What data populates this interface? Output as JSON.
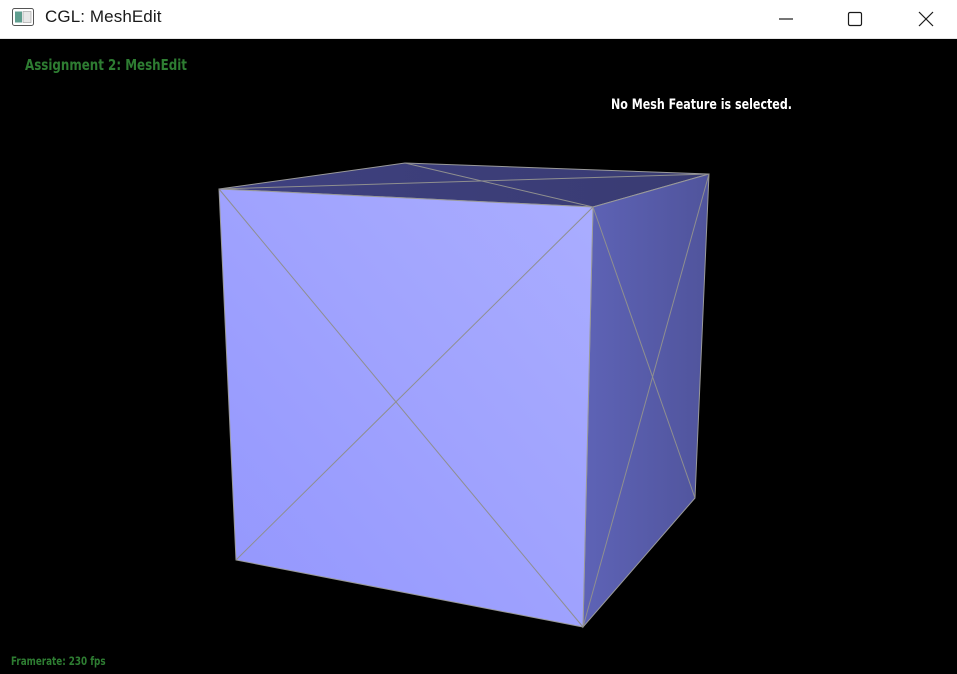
{
  "window": {
    "title": "CGL: MeshEdit",
    "controls": {
      "minimize": "minimize-icon",
      "maximize": "maximize-icon",
      "close": "close-icon"
    }
  },
  "viewport": {
    "background": "#000000",
    "assignment_title": "Assignment 2: MeshEdit",
    "selection_status": "No Mesh Feature is selected.",
    "framerate": "Framerate: 230 fps"
  },
  "mesh": {
    "shape": "cube",
    "face_colors": {
      "front": "#a0a3fe",
      "right": "#5a5fae",
      "top": "#3c3e78"
    },
    "edge_color": "#9a9a9a",
    "text_color_green": "#2e7d32"
  }
}
